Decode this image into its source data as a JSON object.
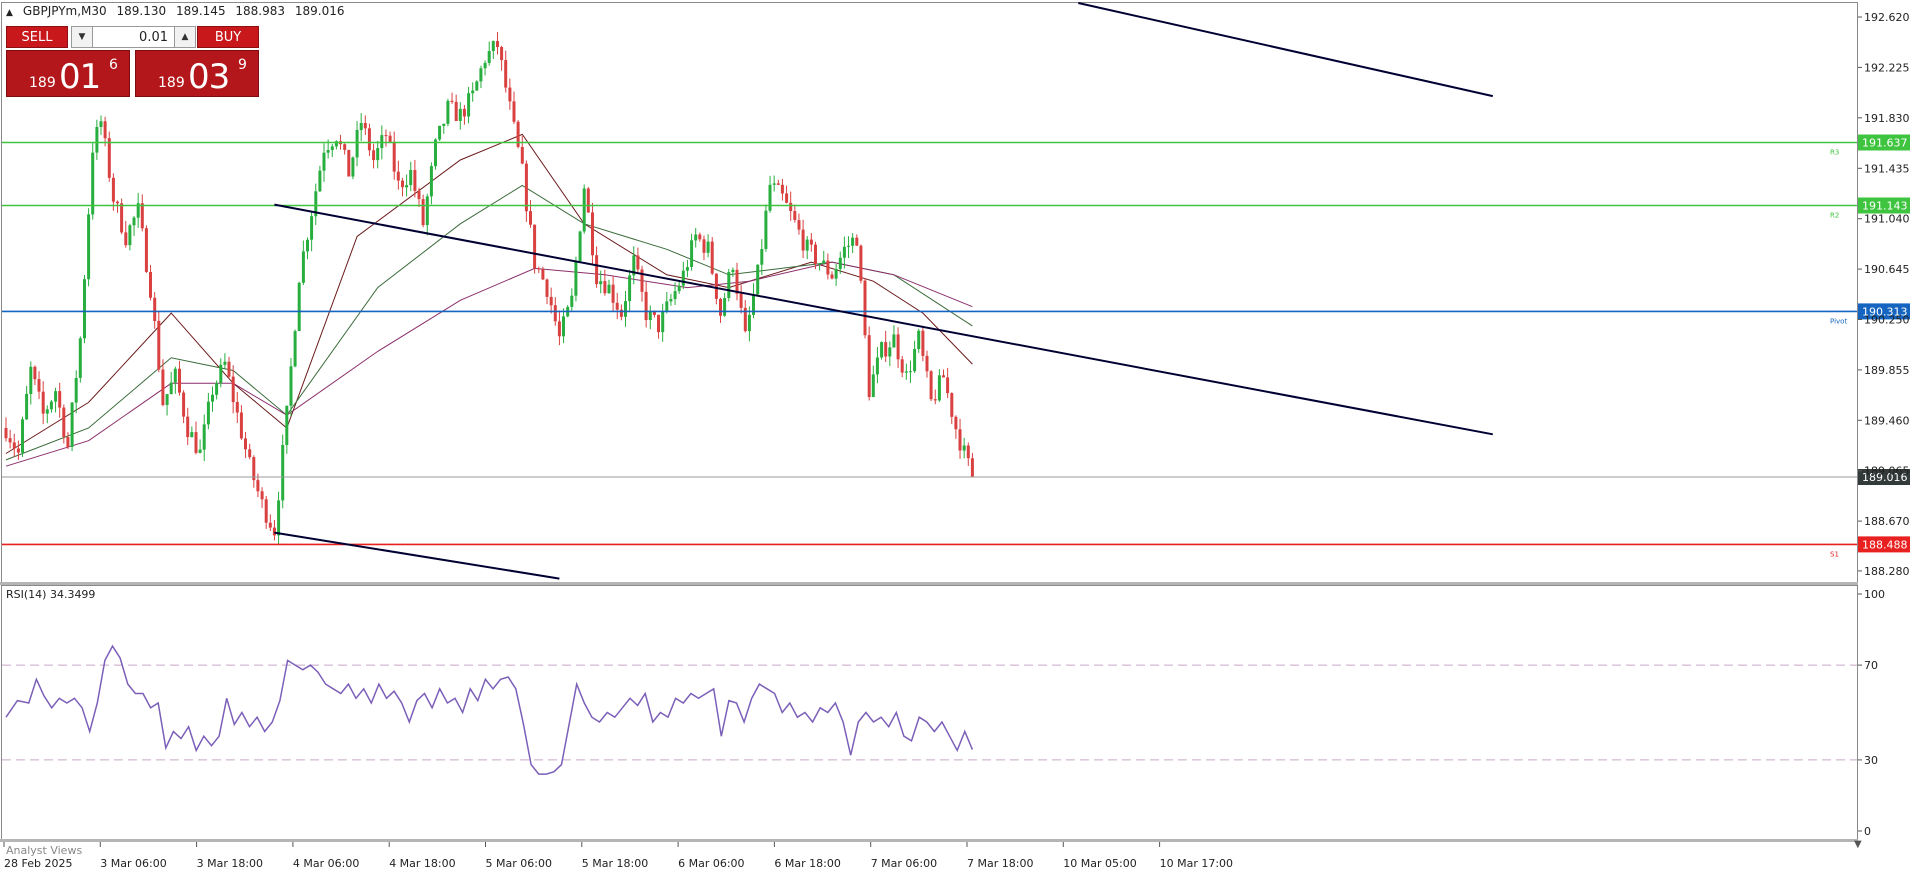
{
  "header": {
    "symbol": "GBPJPYm,M30",
    "open": "189.130",
    "high": "189.145",
    "low": "188.983",
    "close": "189.016"
  },
  "trade_panel": {
    "sell_label": "SELL",
    "buy_label": "BUY",
    "lot_value": "0.01",
    "bid": {
      "prefix": "189",
      "big": "01",
      "sup": "6"
    },
    "ask": {
      "prefix": "189",
      "big": "03",
      "sup": "9"
    },
    "button_color": "#c8181c"
  },
  "footer": {
    "analyst_views": "Analyst Views"
  },
  "colors": {
    "bull": "#27ae3e",
    "bear": "#d94040",
    "resistance": "#3ec43e",
    "pivot": "#1565c0",
    "support": "#e82020",
    "trend": "#000033",
    "rsi": "#7b5fb8",
    "ma_fast": "#6b1a1a",
    "ma_mid": "#3a6b3a",
    "ma_slow": "#8b2f6b"
  },
  "chart_data": [
    {
      "type": "candlestick",
      "symbol": "GBPJPYm",
      "timeframe": "M30",
      "x_ticks": [
        "28 Feb 2025",
        "3 Mar 06:00",
        "3 Mar 18:00",
        "4 Mar 06:00",
        "4 Mar 18:00",
        "5 Mar 06:00",
        "5 Mar 18:00",
        "6 Mar 06:00",
        "6 Mar 18:00",
        "7 Mar 06:00",
        "7 Mar 18:00",
        "10 Mar 05:00",
        "10 Mar 17:00"
      ],
      "y_ticks": [
        "192.620",
        "192.225",
        "191.830",
        "191.435",
        "191.040",
        "190.645",
        "190.250",
        "189.855",
        "189.460",
        "189.065",
        "188.670",
        "188.280"
      ],
      "ylim": [
        188.1,
        192.8
      ],
      "close_path": [
        [
          0,
          189.4
        ],
        [
          3,
          189.2
        ],
        [
          6,
          189.85
        ],
        [
          9,
          189.5
        ],
        [
          12,
          189.7
        ],
        [
          15,
          189.25
        ],
        [
          18,
          190.1
        ],
        [
          21,
          191.6
        ],
        [
          23,
          191.8
        ],
        [
          26,
          191.2
        ],
        [
          29,
          190.9
        ],
        [
          32,
          191.1
        ],
        [
          35,
          190.5
        ],
        [
          38,
          189.6
        ],
        [
          41,
          189.8
        ],
        [
          44,
          189.4
        ],
        [
          47,
          189.2
        ],
        [
          50,
          189.7
        ],
        [
          53,
          189.9
        ],
        [
          56,
          189.5
        ],
        [
          59,
          189.1
        ],
        [
          62,
          188.8
        ],
        [
          65,
          188.6
        ],
        [
          68,
          189.5
        ],
        [
          71,
          190.6
        ],
        [
          74,
          191.1
        ],
        [
          77,
          191.6
        ],
        [
          80,
          191.7
        ],
        [
          83,
          191.4
        ],
        [
          86,
          191.8
        ],
        [
          89,
          191.5
        ],
        [
          92,
          191.7
        ],
        [
          95,
          191.3
        ],
        [
          98,
          191.4
        ],
        [
          101,
          191.0
        ],
        [
          104,
          191.6
        ],
        [
          107,
          191.9
        ],
        [
          110,
          191.85
        ],
        [
          113,
          192.0
        ],
        [
          116,
          192.3
        ],
        [
          119,
          192.4
        ],
        [
          122,
          191.9
        ],
        [
          125,
          191.4
        ],
        [
          128,
          190.7
        ],
        [
          131,
          190.5
        ],
        [
          134,
          190.1
        ],
        [
          137,
          190.4
        ],
        [
          140,
          191.3
        ],
        [
          143,
          190.6
        ],
        [
          146,
          190.5
        ],
        [
          149,
          190.3
        ],
        [
          152,
          190.7
        ],
        [
          155,
          190.3
        ],
        [
          158,
          190.2
        ],
        [
          161,
          190.4
        ],
        [
          164,
          190.6
        ],
        [
          167,
          190.9
        ],
        [
          170,
          190.8
        ],
        [
          173,
          190.3
        ],
        [
          176,
          190.7
        ],
        [
          179,
          190.1
        ],
        [
          182,
          190.6
        ],
        [
          185,
          191.3
        ],
        [
          188,
          191.2
        ],
        [
          191,
          191.0
        ],
        [
          194,
          190.8
        ],
        [
          197,
          190.7
        ],
        [
          200,
          190.6
        ],
        [
          203,
          190.8
        ],
        [
          206,
          190.9
        ],
        [
          209,
          189.7
        ],
        [
          212,
          190.0
        ],
        [
          215,
          190.1
        ],
        [
          218,
          189.8
        ],
        [
          221,
          190.1
        ],
        [
          224,
          189.6
        ],
        [
          227,
          189.8
        ],
        [
          230,
          189.4
        ],
        [
          232,
          189.2
        ],
        [
          234,
          189.016
        ]
      ],
      "moving_averages": [
        {
          "color": "ma_fast",
          "path": [
            [
              0,
              189.2
            ],
            [
              20,
              189.6
            ],
            [
              40,
              190.3
            ],
            [
              55,
              189.75
            ],
            [
              68,
              189.4
            ],
            [
              85,
              190.9
            ],
            [
              110,
              191.5
            ],
            [
              125,
              191.7
            ],
            [
              140,
              191.0
            ],
            [
              160,
              190.6
            ],
            [
              175,
              190.5
            ],
            [
              195,
              190.7
            ],
            [
              210,
              190.55
            ],
            [
              222,
              190.3
            ],
            [
              234,
              189.9
            ]
          ]
        },
        {
          "color": "ma_mid",
          "path": [
            [
              0,
              189.15
            ],
            [
              20,
              189.4
            ],
            [
              40,
              189.95
            ],
            [
              55,
              189.85
            ],
            [
              68,
              189.5
            ],
            [
              90,
              190.5
            ],
            [
              110,
              191.0
            ],
            [
              125,
              191.3
            ],
            [
              140,
              191.0
            ],
            [
              160,
              190.8
            ],
            [
              175,
              190.6
            ],
            [
              200,
              190.7
            ],
            [
              215,
              190.6
            ],
            [
              234,
              190.2
            ]
          ]
        },
        {
          "color": "ma_slow",
          "path": [
            [
              0,
              189.1
            ],
            [
              20,
              189.3
            ],
            [
              40,
              189.75
            ],
            [
              55,
              189.75
            ],
            [
              68,
              189.5
            ],
            [
              90,
              190.0
            ],
            [
              110,
              190.4
            ],
            [
              128,
              190.65
            ],
            [
              145,
              190.6
            ],
            [
              165,
              190.5
            ],
            [
              180,
              190.55
            ],
            [
              200,
              190.7
            ],
            [
              215,
              190.6
            ],
            [
              234,
              190.35
            ]
          ]
        }
      ],
      "horizontal_levels": [
        {
          "price_label": "191.637",
          "color": "resistance",
          "tag": "R3"
        },
        {
          "price_label": "191.143",
          "color": "resistance",
          "tag": "R2"
        },
        {
          "price_label": "190.313",
          "color": "pivot",
          "tag": "Pivot"
        },
        {
          "price_label": "189.016",
          "color": "#9a9a9a",
          "tag": ""
        },
        {
          "price_label": "188.488",
          "color": "support",
          "tag": "S1"
        }
      ],
      "trend_lines": [
        {
          "from": [
            65,
            191.15
          ],
          "to": [
            360,
            189.35
          ]
        },
        {
          "from": [
            65,
            188.58
          ],
          "to": [
            134,
            188.22
          ]
        },
        {
          "from": [
            250,
            192.8
          ],
          "to": [
            360,
            192.0
          ]
        }
      ]
    },
    {
      "type": "line",
      "title": "RSI(14) 34.3499",
      "ylim": [
        0,
        100
      ],
      "y_ticks": [
        "100",
        "70",
        "30",
        "0"
      ],
      "levels": [
        70,
        30
      ],
      "series": [
        {
          "values": [
            [
              0,
              48
            ],
            [
              3,
              55
            ],
            [
              6,
              54
            ],
            [
              8,
              64
            ],
            [
              10,
              57
            ],
            [
              12,
              52
            ],
            [
              14,
              56
            ],
            [
              16,
              54
            ],
            [
              18,
              56
            ],
            [
              20,
              52
            ],
            [
              22,
              42
            ],
            [
              24,
              54
            ],
            [
              26,
              72
            ],
            [
              28,
              78
            ],
            [
              30,
              73
            ],
            [
              32,
              62
            ],
            [
              34,
              58
            ],
            [
              36,
              58
            ],
            [
              38,
              52
            ],
            [
              40,
              54
            ],
            [
              42,
              35
            ],
            [
              44,
              42
            ],
            [
              46,
              39
            ],
            [
              48,
              44
            ],
            [
              50,
              34
            ],
            [
              52,
              40
            ],
            [
              54,
              36
            ],
            [
              56,
              40
            ],
            [
              58,
              56
            ],
            [
              60,
              45
            ],
            [
              62,
              50
            ],
            [
              64,
              44
            ],
            [
              66,
              48
            ],
            [
              68,
              42
            ],
            [
              70,
              46
            ],
            [
              72,
              55
            ],
            [
              74,
              72
            ],
            [
              76,
              70
            ],
            [
              78,
              68
            ],
            [
              80,
              70
            ],
            [
              82,
              67
            ],
            [
              84,
              62
            ],
            [
              86,
              60
            ],
            [
              88,
              58
            ],
            [
              90,
              62
            ],
            [
              92,
              56
            ],
            [
              94,
              60
            ],
            [
              96,
              54
            ],
            [
              98,
              62
            ],
            [
              100,
              56
            ],
            [
              102,
              59
            ],
            [
              104,
              54
            ],
            [
              106,
              46
            ],
            [
              108,
              55
            ],
            [
              110,
              58
            ],
            [
              112,
              52
            ],
            [
              114,
              60
            ],
            [
              116,
              54
            ],
            [
              118,
              56
            ],
            [
              120,
              50
            ],
            [
              122,
              60
            ],
            [
              124,
              55
            ],
            [
              126,
              64
            ],
            [
              128,
              60
            ],
            [
              130,
              64
            ],
            [
              132,
              65
            ],
            [
              134,
              60
            ],
            [
              136,
              45
            ],
            [
              138,
              28
            ],
            [
              140,
              24
            ],
            [
              142,
              24
            ],
            [
              144,
              25
            ],
            [
              146,
              28
            ],
            [
              148,
              45
            ],
            [
              150,
              62
            ],
            [
              152,
              54
            ],
            [
              154,
              48
            ],
            [
              156,
              46
            ],
            [
              158,
              50
            ],
            [
              160,
              48
            ],
            [
              162,
              52
            ],
            [
              164,
              56
            ],
            [
              166,
              53
            ],
            [
              168,
              58
            ],
            [
              170,
              46
            ],
            [
              172,
              50
            ],
            [
              174,
              48
            ],
            [
              176,
              56
            ],
            [
              178,
              54
            ],
            [
              180,
              58
            ],
            [
              182,
              56
            ],
            [
              184,
              58
            ],
            [
              186,
              60
            ],
            [
              188,
              40
            ],
            [
              190,
              55
            ],
            [
              192,
              54
            ],
            [
              194,
              46
            ],
            [
              196,
              56
            ],
            [
              198,
              62
            ],
            [
              200,
              60
            ],
            [
              202,
              58
            ],
            [
              204,
              50
            ],
            [
              206,
              54
            ],
            [
              208,
              48
            ],
            [
              210,
              50
            ],
            [
              212,
              46
            ],
            [
              214,
              52
            ],
            [
              216,
              50
            ],
            [
              218,
              54
            ],
            [
              220,
              46
            ],
            [
              222,
              32
            ],
            [
              224,
              46
            ],
            [
              226,
              50
            ],
            [
              228,
              46
            ],
            [
              230,
              48
            ],
            [
              232,
              44
            ],
            [
              234,
              50
            ],
            [
              236,
              40
            ],
            [
              238,
              38
            ],
            [
              240,
              48
            ],
            [
              242,
              46
            ],
            [
              244,
              42
            ],
            [
              246,
              46
            ],
            [
              248,
              40
            ],
            [
              250,
              34
            ],
            [
              252,
              42
            ],
            [
              254,
              34.35
            ]
          ]
        }
      ]
    }
  ]
}
